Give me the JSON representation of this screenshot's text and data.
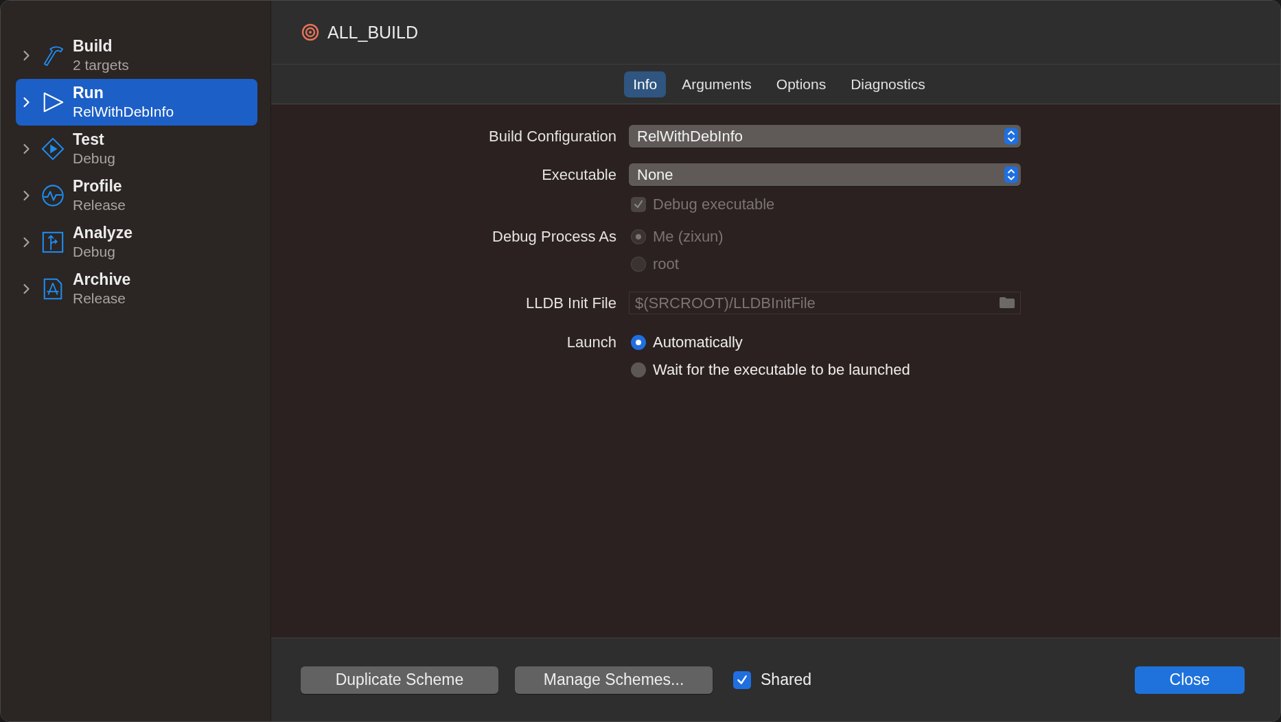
{
  "window": {
    "title": "ALL_BUILD"
  },
  "sidebar": {
    "items": [
      {
        "kind": "build",
        "title": "Build",
        "subtitle": "2 targets",
        "selected": false
      },
      {
        "kind": "run",
        "title": "Run",
        "subtitle": "RelWithDebInfo",
        "selected": true
      },
      {
        "kind": "test",
        "title": "Test",
        "subtitle": "Debug",
        "selected": false
      },
      {
        "kind": "profile",
        "title": "Profile",
        "subtitle": "Release",
        "selected": false
      },
      {
        "kind": "analyze",
        "title": "Analyze",
        "subtitle": "Debug",
        "selected": false
      },
      {
        "kind": "archive",
        "title": "Archive",
        "subtitle": "Release",
        "selected": false
      }
    ]
  },
  "tabs": [
    {
      "label": "Info",
      "selected": true
    },
    {
      "label": "Arguments",
      "selected": false
    },
    {
      "label": "Options",
      "selected": false
    },
    {
      "label": "Diagnostics",
      "selected": false
    }
  ],
  "form": [
    {
      "kind": "popup",
      "label": "Build Configuration",
      "value": "RelWithDebInfo"
    },
    {
      "kind": "popup",
      "label": "Executable",
      "value": "None"
    },
    {
      "kind": "checkbox",
      "text": "Debug executable",
      "checked": true,
      "disabled": true
    },
    {
      "kind": "radio",
      "label": "Debug Process As",
      "text": "Me (zixun)",
      "selected": true,
      "disabled": true
    },
    {
      "kind": "radio",
      "text": "root",
      "selected": false,
      "disabled": true
    },
    {
      "kind": "file",
      "label": "LLDB Init File",
      "placeholder": "$(SRCROOT)/LLDBInitFile"
    },
    {
      "kind": "radio",
      "label": "Launch",
      "text": "Automatically",
      "selected": true,
      "disabled": false
    },
    {
      "kind": "radio",
      "text": "Wait for the executable to be launched",
      "selected": false,
      "disabled": false
    }
  ],
  "footer": {
    "buttons": [
      "Duplicate Scheme",
      "Manage Schemes..."
    ],
    "shared": {
      "label": "Shared",
      "checked": true
    },
    "close": "Close"
  }
}
